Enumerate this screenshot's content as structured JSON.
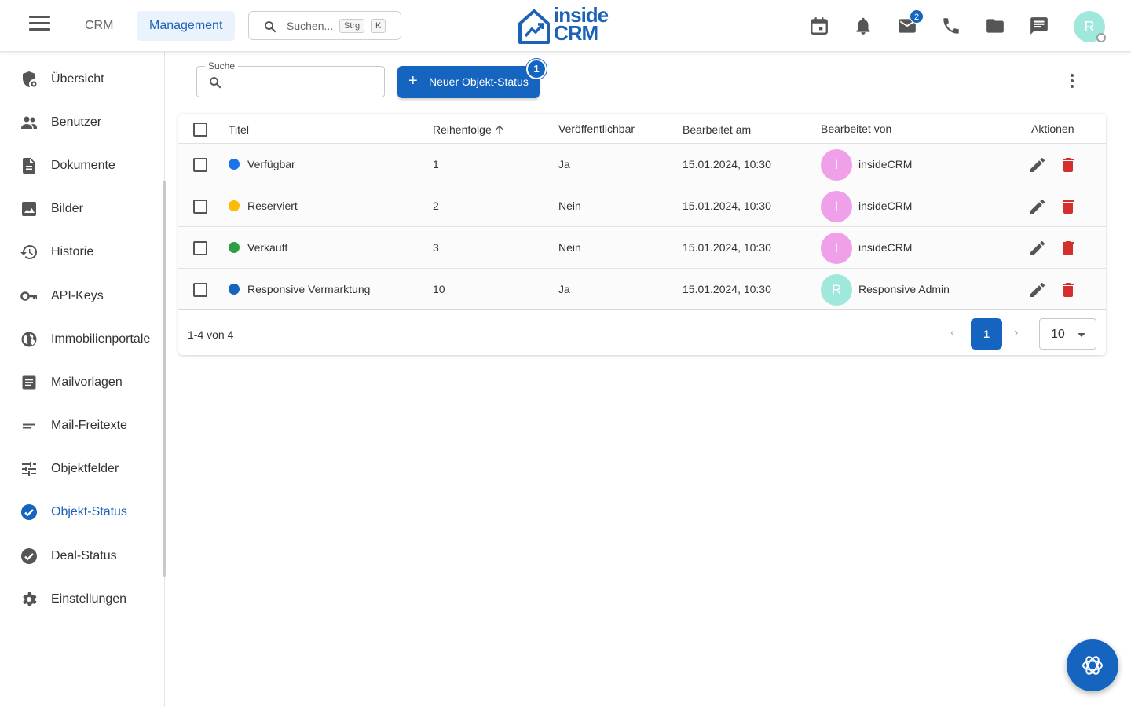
{
  "topbar": {
    "nav_crm": "CRM",
    "nav_management": "Management",
    "search_placeholder": "Suchen...",
    "shortcut_mod": "Strg",
    "shortcut_key": "K",
    "logo_line1": "inside",
    "logo_line2": "CRM",
    "mail_badge": "2",
    "user_initial": "R"
  },
  "sidebar": {
    "items": [
      {
        "label": "Übersicht",
        "icon": "dashboard-shield-icon"
      },
      {
        "label": "Benutzer",
        "icon": "people-icon"
      },
      {
        "label": "Dokumente",
        "icon": "document-icon"
      },
      {
        "label": "Bilder",
        "icon": "image-icon"
      },
      {
        "label": "Historie",
        "icon": "history-icon"
      },
      {
        "label": "API-Keys",
        "icon": "key-icon"
      },
      {
        "label": "Immobilienportale",
        "icon": "globe-icon"
      },
      {
        "label": "Mailvorlagen",
        "icon": "article-icon"
      },
      {
        "label": "Mail-Freitexte",
        "icon": "short-text-icon"
      },
      {
        "label": "Objektfelder",
        "icon": "tune-icon"
      },
      {
        "label": "Objekt-Status",
        "icon": "check-circle-icon",
        "active": true
      },
      {
        "label": "Deal-Status",
        "icon": "check-circle-icon"
      },
      {
        "label": "Einstellungen",
        "icon": "gear-icon"
      }
    ]
  },
  "main": {
    "search_label": "Suche",
    "search_value": "",
    "new_button_label": "Neuer Objekt-Status",
    "new_button_badge": "1",
    "table": {
      "headers": [
        "Titel",
        "Reihenfolge",
        "Veröffentlichbar",
        "Bearbeitet am",
        "Bearbeitet von",
        "Aktionen"
      ],
      "rows": [
        {
          "title": "Verfügbar",
          "color": "#1a73e8",
          "order": "1",
          "publishable": "Ja",
          "edited_at": "15.01.2024, 10:30",
          "editor": "insideCRM",
          "editor_initial": "I",
          "avatar_color": "#f0a0e8"
        },
        {
          "title": "Reserviert",
          "color": "#fbbc04",
          "order": "2",
          "publishable": "Nein",
          "edited_at": "15.01.2024, 10:30",
          "editor": "insideCRM",
          "editor_initial": "I",
          "avatar_color": "#f0a0e8"
        },
        {
          "title": "Verkauft",
          "color": "#2e9e44",
          "order": "3",
          "publishable": "Nein",
          "edited_at": "15.01.2024, 10:30",
          "editor": "insideCRM",
          "editor_initial": "I",
          "avatar_color": "#f0a0e8"
        },
        {
          "title": "Responsive Vermarktung",
          "color": "#1565c0",
          "order": "10",
          "publishable": "Ja",
          "edited_at": "15.01.2024, 10:30",
          "editor": "Responsive Admin",
          "editor_initial": "R",
          "avatar_color": "#a0e7dc"
        }
      ]
    },
    "pagination": {
      "range": "1-4 von 4",
      "current_page": "1",
      "per_page": "10"
    }
  },
  "colors": {
    "primary": "#1565c0",
    "delete": "#d32f2f"
  }
}
